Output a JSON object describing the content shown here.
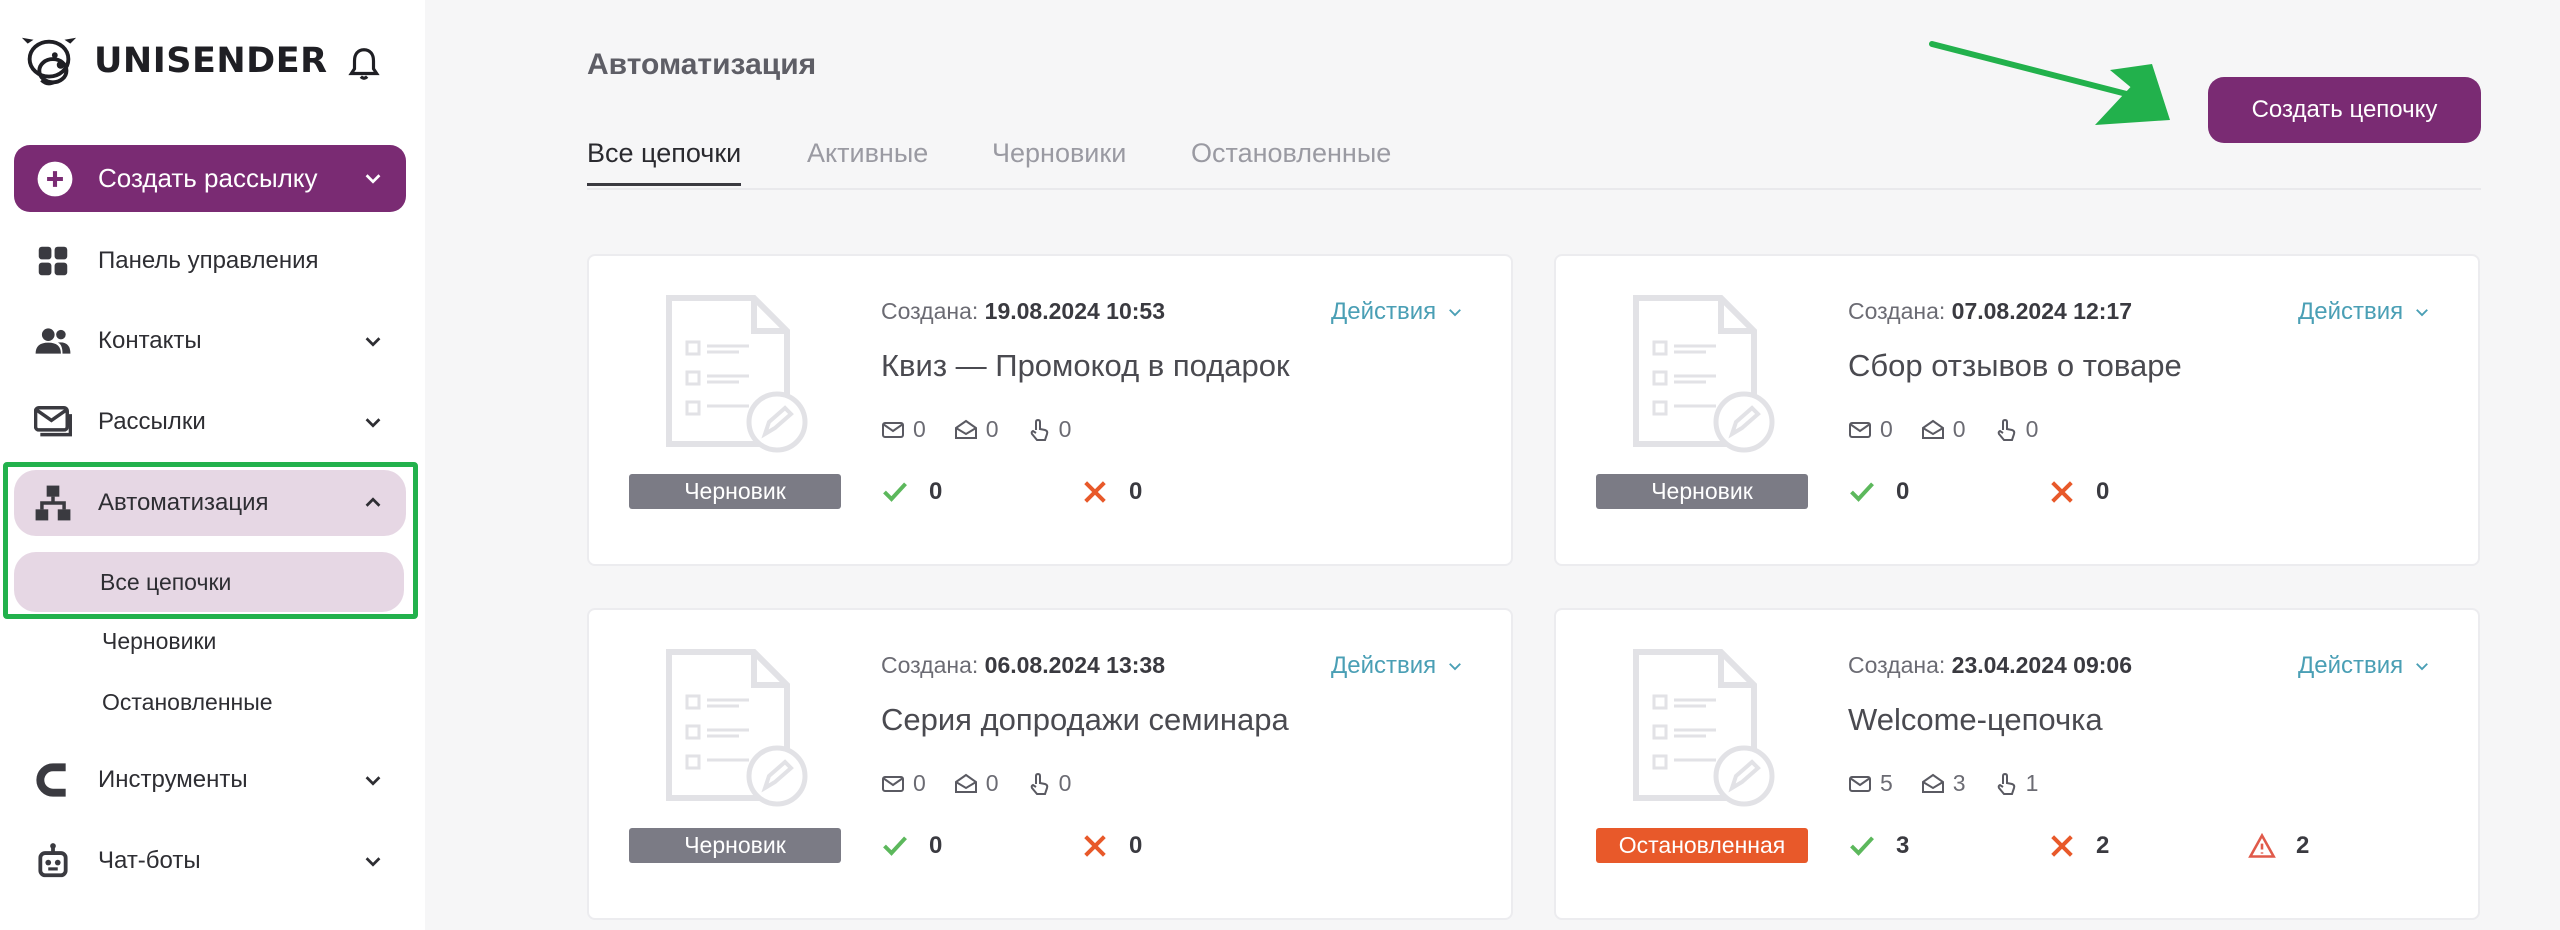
{
  "brand": {
    "name": "UNISENDER"
  },
  "sidebar": {
    "create_button": "Создать рассылку",
    "items": [
      {
        "label": "Панель управления"
      },
      {
        "label": "Контакты"
      },
      {
        "label": "Рассылки"
      },
      {
        "label": "Автоматизация"
      },
      {
        "label": "Инструменты"
      },
      {
        "label": "Чат-боты"
      }
    ],
    "automation_sub": [
      "Все цепочки",
      "Черновики",
      "Остановленные"
    ]
  },
  "header": {
    "title": "Автоматизация",
    "new_chain_button": "Создать цепочку"
  },
  "tabs": [
    "Все цепочки",
    "Активные",
    "Черновики",
    "Остановленные"
  ],
  "card_labels": {
    "created": "Создана:",
    "actions": "Действия"
  },
  "chains": [
    {
      "created": "19.08.2024 10:53",
      "name": "Квиз — Промокод в подарок",
      "sent": "0",
      "opened": "0",
      "clicked": "0",
      "status": "Черновик",
      "success": "0",
      "failed": "0"
    },
    {
      "created": "07.08.2024 12:17",
      "name": "Сбор отзывов о товаре",
      "sent": "0",
      "opened": "0",
      "clicked": "0",
      "status": "Черновик",
      "success": "0",
      "failed": "0"
    },
    {
      "created": "06.08.2024 13:38",
      "name": "Серия допродажи семинара",
      "sent": "0",
      "opened": "0",
      "clicked": "0",
      "status": "Черновик",
      "success": "0",
      "failed": "0"
    },
    {
      "created": "23.04.2024 09:06",
      "name": "Welcome-цепочка",
      "sent": "5",
      "opened": "3",
      "clicked": "1",
      "status": "Остановленная",
      "success": "3",
      "failed": "2",
      "warnings": "2"
    }
  ],
  "colors": {
    "accent": "#7a2b73",
    "draft_badge": "#7b7b85",
    "stopped_badge": "#e8592a",
    "success": "#5cb85c",
    "failed": "#e8592a",
    "highlight": "#22b14c"
  }
}
